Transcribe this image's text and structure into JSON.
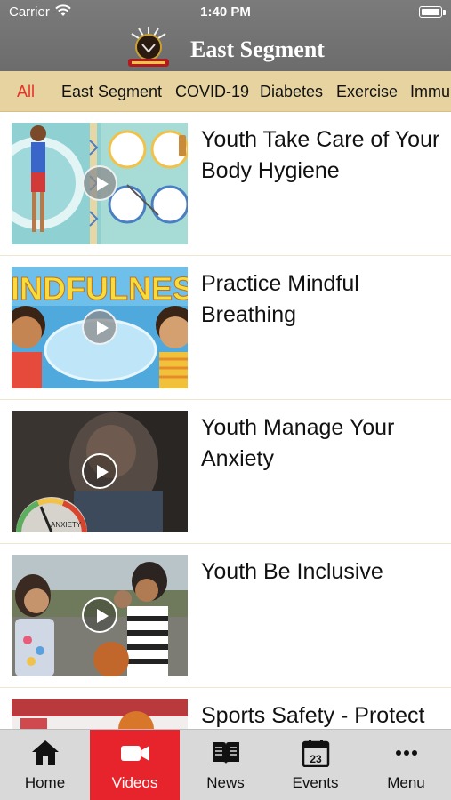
{
  "status_bar": {
    "carrier": "Carrier",
    "time": "1:40 PM"
  },
  "header": {
    "title": "East Segment",
    "logo": "tribal-logo"
  },
  "categories": [
    {
      "label": "All",
      "active": true
    },
    {
      "label": "East Segment",
      "active": false
    },
    {
      "label": "COVID-19",
      "active": false
    },
    {
      "label": "Diabetes",
      "active": false
    },
    {
      "label": "Exercise",
      "active": false
    },
    {
      "label": "Immu",
      "active": false
    }
  ],
  "videos": [
    {
      "title": "Youth Take Care of Your Body Hygiene",
      "thumb_icon": "hygiene-thumbnail"
    },
    {
      "title": "Practice Mindful Breathing",
      "thumb_icon": "mindfulness-thumbnail",
      "thumb_text": "MINDFULNESS"
    },
    {
      "title": "Youth Manage Your Anxiety",
      "thumb_icon": "anxiety-thumbnail",
      "thumb_text": "ANXIETY"
    },
    {
      "title": "Youth Be Inclusive",
      "thumb_icon": "inclusive-thumbnail"
    },
    {
      "title": "Sports Safety - Protect",
      "thumb_icon": "sports-thumbnail"
    }
  ],
  "tabbar": [
    {
      "label": "Home",
      "icon": "home-icon",
      "active": false
    },
    {
      "label": "Videos",
      "icon": "video-camera-icon",
      "active": true
    },
    {
      "label": "News",
      "icon": "book-icon",
      "active": false
    },
    {
      "label": "Events",
      "icon": "calendar-icon",
      "active": false,
      "badge": "23"
    },
    {
      "label": "Menu",
      "icon": "more-icon",
      "active": false
    }
  ],
  "colors": {
    "accent": "#e7242b",
    "tab_strip": "#e6d3a0",
    "header": "#747474"
  }
}
